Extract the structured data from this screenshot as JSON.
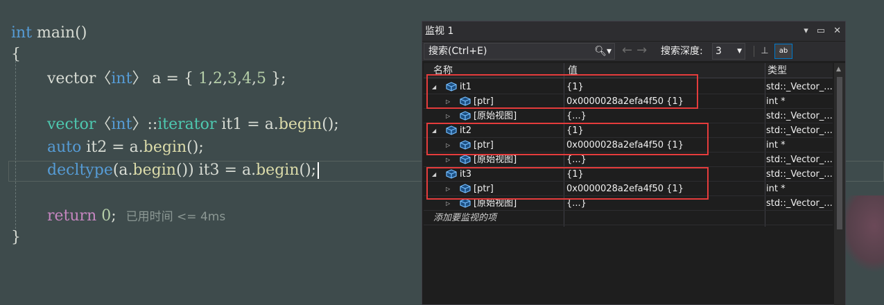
{
  "editor": {
    "elapsed": "已用时间 <= 4ms"
  },
  "watch": {
    "title": "监视 1",
    "title_buttons": {
      "dropdown": "▾",
      "maximize": "▭",
      "close": "✕"
    },
    "search_placeholder": "搜索(Ctrl+E)",
    "depth_label": "搜索深度:",
    "depth_value": "3",
    "columns": {
      "name": "名称",
      "value": "值",
      "type": "类型"
    },
    "rows": [
      {
        "name": "it1",
        "value": "{1}",
        "type": "std::_Vector_...",
        "level": 0,
        "expanded": true
      },
      {
        "name": "[ptr]",
        "value": "0x0000028a2efa4f50 {1}",
        "type": "int *",
        "level": 1,
        "expanded": false
      },
      {
        "name": "[原始视图]",
        "value": "{...}",
        "type": "std::_Vector_...",
        "level": 1,
        "expanded": false
      },
      {
        "name": "it2",
        "value": "{1}",
        "type": "std::_Vector_...",
        "level": 0,
        "expanded": true
      },
      {
        "name": "[ptr]",
        "value": "0x0000028a2efa4f50 {1}",
        "type": "int *",
        "level": 1,
        "expanded": false
      },
      {
        "name": "[原始视图]",
        "value": "{...}",
        "type": "std::_Vector_...",
        "level": 1,
        "expanded": false
      },
      {
        "name": "it3",
        "value": "{1}",
        "type": "std::_Vector_...",
        "level": 0,
        "expanded": true
      },
      {
        "name": "[ptr]",
        "value": "0x0000028a2efa4f50 {1}",
        "type": "int *",
        "level": 1,
        "expanded": false
      },
      {
        "name": "[原始视图]",
        "value": "{...}",
        "type": "std::_Vector_...",
        "level": 1,
        "expanded": false
      }
    ],
    "add_row": "添加要监视的项"
  },
  "colors": {
    "editor_bg": "#3e4b4c",
    "watch_bg": "#1e1e1e",
    "highlight": "#e53c3c",
    "keyword": "#569cd6",
    "type": "#4ec9b0",
    "function": "#dcdcaa",
    "number": "#b5cea8",
    "return_kw": "#c586c0"
  }
}
